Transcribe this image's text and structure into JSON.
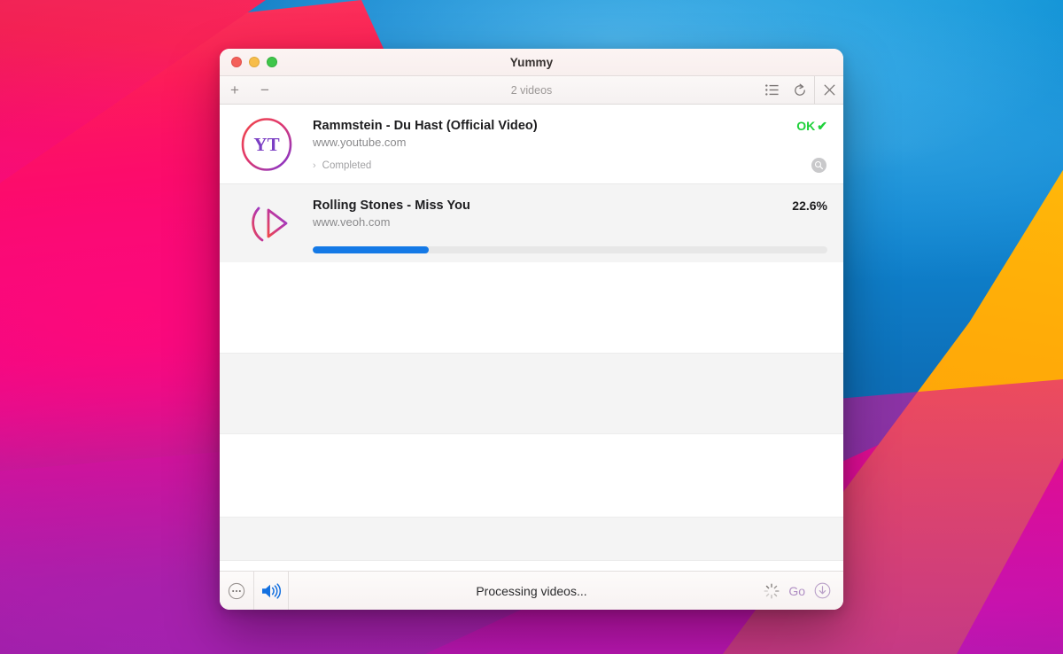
{
  "window": {
    "title": "Yummy",
    "traffic_lights": [
      "close",
      "minimize",
      "zoom"
    ]
  },
  "toolbar": {
    "add_label": "+",
    "remove_label": "−",
    "count_label": "2 videos",
    "list_icon": "list-icon",
    "refresh_icon": "refresh-icon",
    "close_icon": "close-icon"
  },
  "videos": [
    {
      "title": "Rammstein - Du Hast (Official Video)",
      "url": "www.youtube.com",
      "status": "OK",
      "status_check": "✔",
      "status_type": "ok",
      "detail": "Completed",
      "chevron": "›",
      "icon": "youtube-icon",
      "icon_label": "YT",
      "row_style": "white"
    },
    {
      "title": "Rolling Stones - Miss You",
      "url": "www.veoh.com",
      "status": "22.6%",
      "status_type": "percent",
      "progress": 22.6,
      "icon": "veoh-icon",
      "row_style": "gray"
    }
  ],
  "empty_rows": [
    "white",
    "gray",
    "white",
    "gray"
  ],
  "bottombar": {
    "more_icon": "ellipsis-circle-icon",
    "sound_icon": "speaker-icon",
    "status_text": "Processing videos...",
    "spinner_icon": "spinner-icon",
    "go_label": "Go",
    "download_icon": "download-circle-icon"
  },
  "colors": {
    "accent_blue": "#1479e6",
    "ok_green": "#1fd13b",
    "go_purple": "#b08fc4",
    "speaker_blue": "#1370e0",
    "icon_gradient_start": "#f04a4a",
    "icon_gradient_end": "#8d3fd6"
  }
}
